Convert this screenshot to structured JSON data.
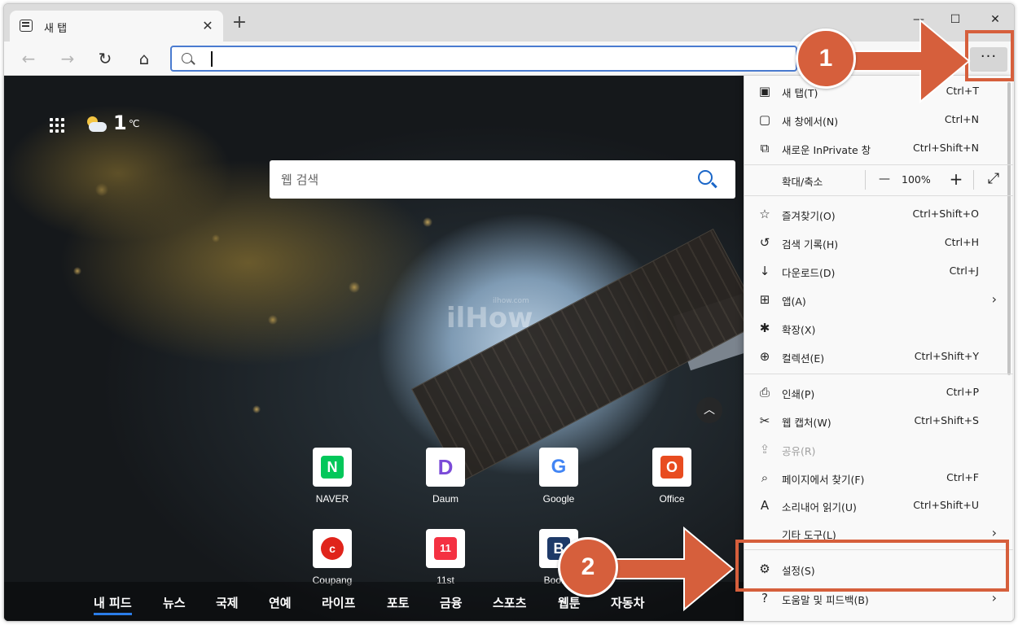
{
  "tab": {
    "title": "새 탭",
    "close": "✕"
  },
  "window": {
    "minimize": "—",
    "maximize": "☐",
    "close": "✕",
    "newtab": "+"
  },
  "toolbar": {
    "back": "←",
    "forward": "→",
    "refresh": "↻",
    "home": "⌂",
    "more": "···"
  },
  "weather": {
    "temp": "1",
    "unit": "℃"
  },
  "search": {
    "placeholder": "웹 검색"
  },
  "watermark": {
    "brand": "ilHow",
    "site": "ilhow.com"
  },
  "tiles": [
    {
      "label": "NAVER",
      "glyph": "N",
      "color": "#03c75a"
    },
    {
      "label": "Daum",
      "glyph": "D",
      "color": "#ffffff"
    },
    {
      "label": "Google",
      "glyph": "G",
      "color": "#ffffff"
    },
    {
      "label": "Office",
      "glyph": "O",
      "color": "#e84c20"
    },
    {
      "label": "Coupang",
      "glyph": "c",
      "color": "#e0241b"
    },
    {
      "label": "11st",
      "glyph": "11",
      "color": "#f43142"
    },
    {
      "label": "Bookin",
      "glyph": "B",
      "color": "#1e3a68"
    }
  ],
  "feed": [
    "내 피드",
    "뉴스",
    "국제",
    "연예",
    "라이프",
    "포토",
    "금융",
    "스포츠",
    "웹툰",
    "자동차"
  ],
  "menu": {
    "items": [
      {
        "label": "새 탭(T)",
        "shortcut": "Ctrl+T",
        "icon": "new-tab-icon"
      },
      {
        "label": "새 창에서(N)",
        "shortcut": "Ctrl+N",
        "icon": "new-window-icon"
      },
      {
        "label": "새로운 InPrivate 창",
        "shortcut": "Ctrl+Shift+N",
        "icon": "inprivate-icon"
      },
      {
        "label": "즐겨찾기(O)",
        "shortcut": "Ctrl+Shift+O",
        "icon": "favorites-icon"
      },
      {
        "label": "검색 기록(H)",
        "shortcut": "Ctrl+H",
        "icon": "history-icon"
      },
      {
        "label": "다운로드(D)",
        "shortcut": "Ctrl+J",
        "icon": "download-icon"
      },
      {
        "label": "앱(A)",
        "shortcut": "",
        "icon": "apps-icon"
      },
      {
        "label": "확장(X)",
        "shortcut": "",
        "icon": "extensions-icon"
      },
      {
        "label": "컬렉션(E)",
        "shortcut": "Ctrl+Shift+Y",
        "icon": "collections-icon"
      },
      {
        "label": "인쇄(P)",
        "shortcut": "Ctrl+P",
        "icon": "print-icon"
      },
      {
        "label": "웹 캡처(W)",
        "shortcut": "Ctrl+Shift+S",
        "icon": "web-capture-icon"
      },
      {
        "label": "공유(R)",
        "shortcut": "",
        "icon": "share-icon"
      },
      {
        "label": "페이지에서 찾기(F)",
        "shortcut": "Ctrl+F",
        "icon": "find-icon"
      },
      {
        "label": "소리내어 읽기(U)",
        "shortcut": "Ctrl+Shift+U",
        "icon": "read-aloud-icon"
      },
      {
        "label": "기타 도구(L)",
        "shortcut": "",
        "icon": "more-tools-icon"
      },
      {
        "label": "설정(S)",
        "shortcut": "",
        "icon": "settings-icon"
      },
      {
        "label": "도움말 및 피드백(B)",
        "shortcut": "",
        "icon": "help-icon"
      }
    ],
    "zoom": {
      "label": "확대/축소",
      "minus": "—",
      "value": "100%",
      "plus": "+",
      "fullscreen": "⤢"
    }
  },
  "annotations": {
    "step1": "1",
    "step2": "2",
    "color": "#d65f3c"
  }
}
